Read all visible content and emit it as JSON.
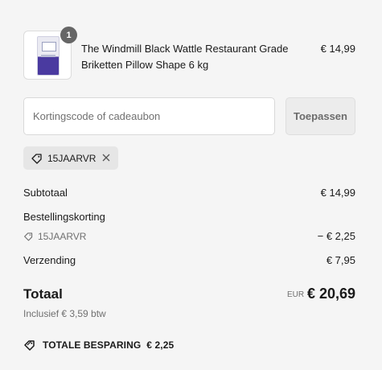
{
  "cart": {
    "item": {
      "quantity": "1",
      "name": "The Windmill Black Wattle Restaurant Grade Briketten Pillow Shape 6 kg",
      "price": "€ 14,99"
    }
  },
  "discount": {
    "placeholder": "Kortingscode of cadeaubon",
    "apply_label": "Toepassen",
    "applied_code": "15JAARVR"
  },
  "summary": {
    "subtotal_label": "Subtotaal",
    "subtotal_value": "€ 14,99",
    "order_discount_label": "Bestellingskorting",
    "order_discount_code": "15JAARVR",
    "order_discount_value": "− € 2,25",
    "shipping_label": "Verzending",
    "shipping_value": "€ 7,95",
    "total_label": "Totaal",
    "total_currency": "EUR",
    "total_value": "€ 20,69",
    "tax_note": "Inclusief € 3,59 btw",
    "savings_label": "TOTALE BESPARING",
    "savings_value": "€ 2,25"
  },
  "icons": {
    "tag": "tag-icon",
    "close": "close-icon"
  },
  "colors": {
    "background": "#f5f5f5",
    "muted_text": "#707070",
    "badge": "#666666"
  }
}
